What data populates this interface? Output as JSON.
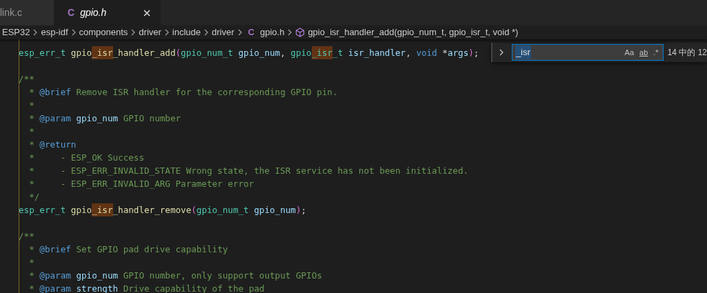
{
  "tabs": [
    {
      "label": "link.c",
      "selected": false
    },
    {
      "label": "gpio.h",
      "selected": true,
      "icon_text": "C"
    }
  ],
  "breadcrumbs": [
    {
      "kind": "folder",
      "label": "ESP32"
    },
    {
      "kind": "folder",
      "label": "esp-idf"
    },
    {
      "kind": "folder",
      "label": "components"
    },
    {
      "kind": "folder",
      "label": "driver"
    },
    {
      "kind": "folder",
      "label": "include"
    },
    {
      "kind": "folder",
      "label": "driver"
    },
    {
      "kind": "file",
      "label": "gpio.h",
      "icon_text": "C"
    },
    {
      "kind": "symbol",
      "label": "gpio_isr_handler_add(gpio_num_t, gpio_isr_t, void *)"
    }
  ],
  "find_widget": {
    "expanded": false,
    "value": "_isr",
    "options": [
      {
        "label": "Aa",
        "on": false
      },
      {
        "label": "ab",
        "on": false
      },
      {
        "label": ".*",
        "on": false
      }
    ],
    "result": "14 中的 12"
  },
  "code_blocks": [
    [
      [
        {
          "text": "esp_err_t ",
          "kind": "type"
        },
        {
          "text": "gpio",
          "kind": "fn"
        },
        {
          "text": "_isr",
          "kind": "fn",
          "match": true
        },
        {
          "text": "_handler_add",
          "kind": "fn"
        },
        {
          "text": "(",
          "kind": "paren"
        },
        {
          "text": "gpio_num_t ",
          "kind": "type"
        },
        {
          "text": "gpio_num",
          "kind": "param"
        },
        {
          "text": ", ",
          "kind": "plain"
        },
        {
          "text": "gpio",
          "kind": "type"
        },
        {
          "text": "_isr",
          "kind": "type",
          "match": true
        },
        {
          "text": "_t ",
          "kind": "type"
        },
        {
          "text": "isr_handler",
          "kind": "param"
        },
        {
          "text": ", ",
          "kind": "plain"
        },
        {
          "text": "void ",
          "kind": "keyword"
        },
        {
          "text": "*",
          "kind": "plain"
        },
        {
          "text": "args",
          "kind": "param"
        },
        {
          "text": ")",
          "kind": "paren"
        },
        {
          "text": ";",
          "kind": "plain"
        }
      ]
    ],
    [
      [
        {
          "text": "/**",
          "kind": "comment"
        }
      ],
      [
        {
          "text": "  * ",
          "kind": "comment"
        },
        {
          "text": "@brief",
          "kind": "tag"
        },
        {
          "text": " Remove ISR handler for the corresponding GPIO pin.",
          "kind": "comment"
        }
      ],
      [
        {
          "text": "  *",
          "kind": "comment"
        }
      ],
      [
        {
          "text": "  * ",
          "kind": "comment"
        },
        {
          "text": "@param",
          "kind": "tag"
        },
        {
          "text": " gpio_num",
          "kind": "param"
        },
        {
          "text": " GPIO number",
          "kind": "comment"
        }
      ],
      [
        {
          "text": "  *",
          "kind": "comment"
        }
      ],
      [
        {
          "text": "  * ",
          "kind": "comment"
        },
        {
          "text": "@return",
          "kind": "tag"
        }
      ],
      [
        {
          "text": "  *     - ESP_OK Success",
          "kind": "comment"
        }
      ],
      [
        {
          "text": "  *     - ESP_ERR_INVALID_STATE Wrong state, the ISR service has not been initialized.",
          "kind": "comment"
        }
      ],
      [
        {
          "text": "  *     - ESP_ERR_INVALID_ARG Parameter error",
          "kind": "comment"
        }
      ],
      [
        {
          "text": "  */",
          "kind": "comment"
        }
      ],
      [
        {
          "text": "esp_err_t ",
          "kind": "type"
        },
        {
          "text": "gpio",
          "kind": "fn"
        },
        {
          "text": "_isr",
          "kind": "fn",
          "match": true
        },
        {
          "text": "_handler_remove",
          "kind": "fn"
        },
        {
          "text": "(",
          "kind": "paren"
        },
        {
          "text": "gpio_num_t ",
          "kind": "type"
        },
        {
          "text": "gpio_num",
          "kind": "param"
        },
        {
          "text": ")",
          "kind": "paren"
        },
        {
          "text": ";",
          "kind": "plain"
        }
      ]
    ],
    [
      [
        {
          "text": "/**",
          "kind": "comment"
        }
      ],
      [
        {
          "text": "  * ",
          "kind": "comment"
        },
        {
          "text": "@brief",
          "kind": "tag"
        },
        {
          "text": " Set GPIO pad drive capability",
          "kind": "comment"
        }
      ],
      [
        {
          "text": "  *",
          "kind": "comment"
        }
      ],
      [
        {
          "text": "  * ",
          "kind": "comment"
        },
        {
          "text": "@param",
          "kind": "tag"
        },
        {
          "text": " gpio_num",
          "kind": "param"
        },
        {
          "text": " GPIO number, only support output GPIOs",
          "kind": "comment"
        }
      ],
      [
        {
          "text": "  * ",
          "kind": "comment"
        },
        {
          "text": "@param",
          "kind": "tag"
        },
        {
          "text": " strength",
          "kind": "param"
        },
        {
          "text": " Drive capability of the pad",
          "kind": "comment"
        }
      ]
    ]
  ]
}
